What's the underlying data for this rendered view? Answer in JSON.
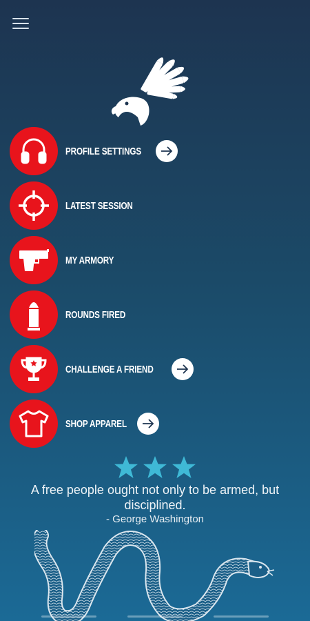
{
  "header": {
    "menu_icon": "hamburger-menu-icon"
  },
  "logo": {
    "icon": "eagle-bullet-wing-logo"
  },
  "menu": {
    "items": [
      {
        "label": "PROFILE SETTINGS",
        "icon": "headphones-icon",
        "has_arrow": true
      },
      {
        "label": "LATEST SESSION",
        "icon": "crosshair-icon",
        "has_arrow": false
      },
      {
        "label": "MY ARMORY",
        "icon": "pistol-icon",
        "has_arrow": false
      },
      {
        "label": "ROUNDS FIRED",
        "icon": "bullet-icon",
        "has_arrow": false
      },
      {
        "label": "CHALLENGE A FRIEND",
        "icon": "trophy-icon",
        "has_arrow": true
      },
      {
        "label": "SHOP APPAREL",
        "icon": "tshirt-icon",
        "has_arrow": true
      }
    ]
  },
  "rating": {
    "stars": 3
  },
  "quote": {
    "text": "A free people ought not only to be armed, but disciplined.",
    "author": "- George Washington"
  },
  "colors": {
    "accent_red": "#e8141c",
    "star": "#3fb9d6"
  }
}
